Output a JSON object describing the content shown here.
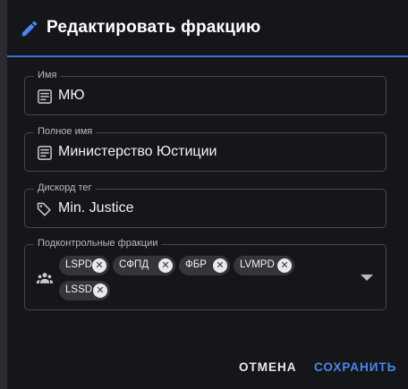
{
  "dialog": {
    "title": "Редактировать фракцию",
    "edit_icon": "pencil-icon",
    "accent_color": "#3c6fd6"
  },
  "fields": {
    "name": {
      "label": "Имя",
      "value": "МЮ",
      "icon": "notes-icon"
    },
    "full_name": {
      "label": "Полное имя",
      "value": "Министерство Юстиции",
      "icon": "notes-icon"
    },
    "discord_tag": {
      "label": "Дискорд тег",
      "value": "Min. Justice",
      "icon": "tags-icon"
    },
    "subordinate": {
      "label": "Подконтрольные фракции",
      "icon": "group-icon",
      "chips": [
        "LSPD",
        "СФПД",
        "ФБР",
        "LVMPD",
        "LSSD"
      ]
    }
  },
  "actions": {
    "cancel": "ОТМЕНА",
    "save": "СОХРАНИТЬ",
    "save_color": "#4a86f0"
  }
}
